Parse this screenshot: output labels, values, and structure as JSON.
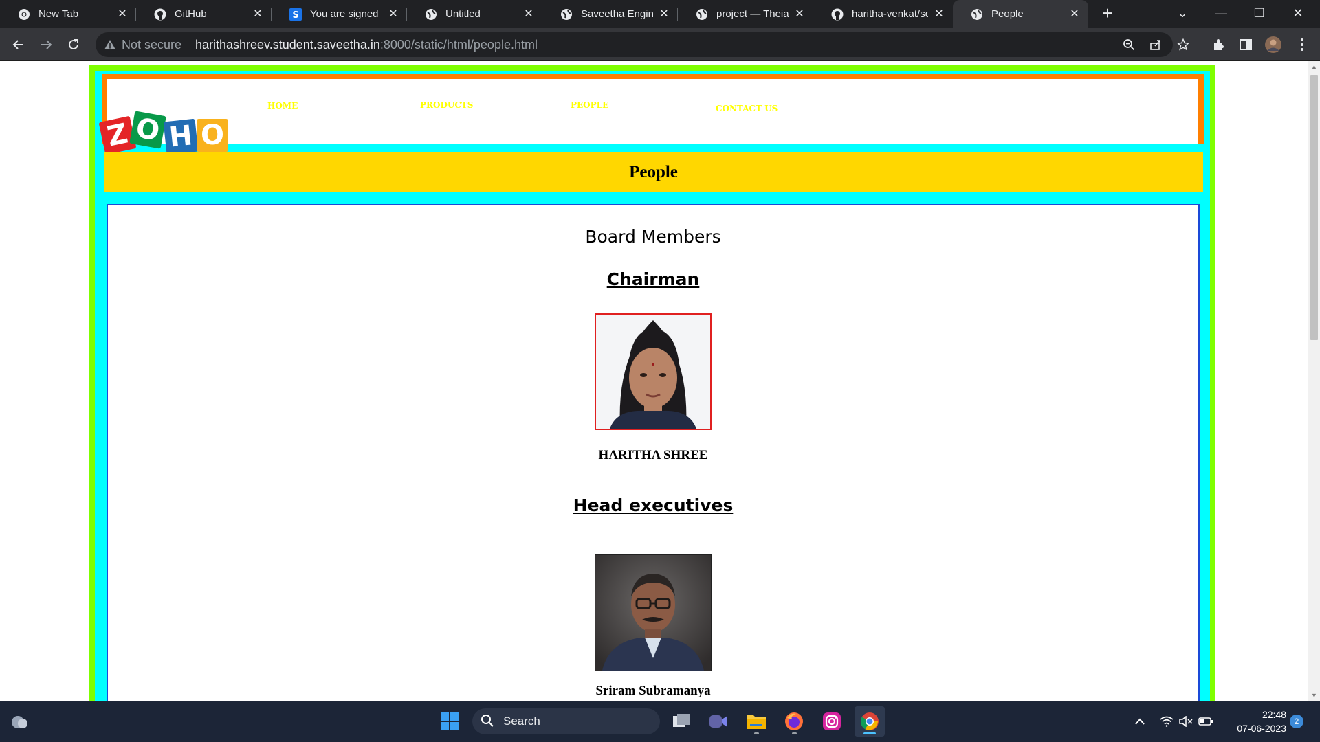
{
  "browser": {
    "tabs": [
      {
        "title": "New Tab",
        "icon": "chrome-icon",
        "active": false
      },
      {
        "title": "GitHub",
        "icon": "github-icon",
        "active": false
      },
      {
        "title": "You are signed in",
        "icon": "s-app-icon",
        "active": false
      },
      {
        "title": "Untitled",
        "icon": "globe-icon",
        "active": false
      },
      {
        "title": "Saveetha Enginee",
        "icon": "globe-icon",
        "active": false
      },
      {
        "title": "project — Theia N",
        "icon": "globe-icon",
        "active": false
      },
      {
        "title": "haritha-venkat/sc",
        "icon": "github-icon",
        "active": false
      },
      {
        "title": "People",
        "icon": "globe-icon",
        "active": true
      }
    ],
    "omnibox": {
      "security": "Not secure",
      "url_host": "harithashreev.student.saveetha.in",
      "url_rest": ":8000/static/html/people.html"
    }
  },
  "page": {
    "nav": {
      "home": "HOME",
      "products": "PRODUCTS",
      "people": "PEOPLE",
      "contact": "CONTACT US"
    },
    "logo": {
      "letters": [
        "Z",
        "O",
        "H",
        "O"
      ]
    },
    "banner_title": "People",
    "board_heading": "Board Members",
    "sections": {
      "chairman": "Chairman",
      "head_executives": "Head executives"
    },
    "people": {
      "chairman_name": "HARITHA SHREE",
      "executive_name": "Sriram Subramanya"
    },
    "colors": {
      "outer_border": "#7fff00",
      "frame": "#00ffff",
      "header_border": "#ff7f00",
      "banner": "#ffd700",
      "nav_text": "#ffff00",
      "content_border": "#1a4ad8"
    }
  },
  "taskbar": {
    "search_label": "Search",
    "time": "22:48",
    "date": "07-06-2023",
    "notifications": "2"
  }
}
